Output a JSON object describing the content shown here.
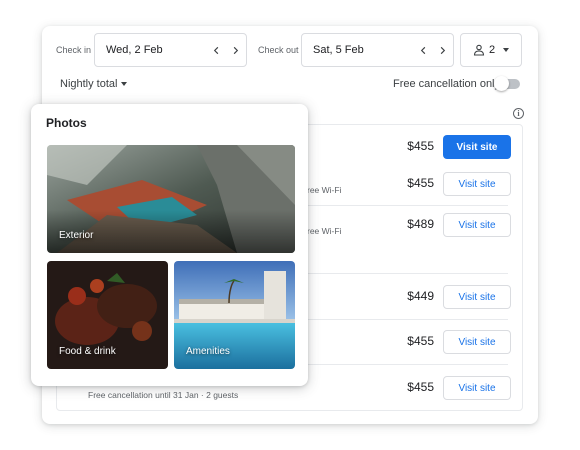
{
  "search": {
    "checkin_label": "Check in",
    "checkin_value": "Wed, 2 Feb",
    "checkout_label": "Check out",
    "checkout_value": "Sat, 5 Feb",
    "guests": "2"
  },
  "filters": {
    "nightly_total": "Nightly total",
    "free_cancellation": "Free cancellation only"
  },
  "offers": [
    {
      "price": "$455",
      "button": "Visit site"
    },
    {
      "price": "$455",
      "button": "Visit site",
      "note": "ree Wi-Fi"
    },
    {
      "price": "$489",
      "button": "Visit site",
      "note": "ree Wi-Fi"
    },
    {
      "price": "$449",
      "button": "Visit site"
    },
    {
      "price": "$455",
      "button": "Visit site"
    },
    {
      "price": "$455",
      "button": "Visit site"
    }
  ],
  "footer_note": "Free cancellation until 31 Jan · 2 guests",
  "photos": {
    "title": "Photos",
    "items": [
      {
        "label": "Exterior"
      },
      {
        "label": "Food & drink"
      },
      {
        "label": "Amenities"
      }
    ]
  },
  "colors": {
    "accent": "#1a73e8",
    "border": "#dadce0"
  }
}
